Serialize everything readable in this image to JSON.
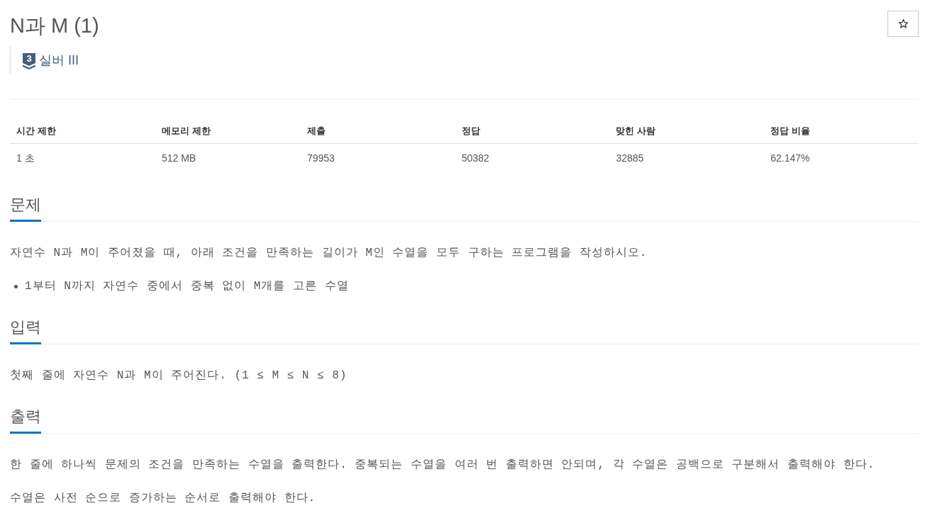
{
  "title": "N과 M (1)",
  "favorite_button": {
    "on": false
  },
  "tier": {
    "level": "3",
    "label": "실버 III"
  },
  "stats": {
    "columns": [
      "시간 제한",
      "메모리 제한",
      "제출",
      "정답",
      "맞힌 사람",
      "정답 비율"
    ],
    "rows": [
      [
        "1 초",
        "512 MB",
        "79953",
        "50382",
        "32885",
        "62.147%"
      ]
    ]
  },
  "sections": [
    {
      "heading": "문제",
      "blocks": [
        {
          "kind": "paragraph",
          "text": "자연수 N과 M이 주어졌을 때, 아래 조건을 만족하는 길이가 M인 수열을 모두 구하는 프로그램을 작성하시오."
        },
        {
          "kind": "bullet_list",
          "items": [
            "1부터 N까지 자연수 중에서 중복 없이 M개를 고른 수열"
          ]
        }
      ]
    },
    {
      "heading": "입력",
      "blocks": [
        {
          "kind": "paragraph",
          "text": "첫째 줄에 자연수 N과 M이 주어진다. (1 ≤ M ≤ N ≤ 8)"
        }
      ]
    },
    {
      "heading": "출력",
      "blocks": [
        {
          "kind": "paragraph",
          "text": "한 줄에 하나씩 문제의 조건을 만족하는 수열을 출력한다. 중복되는 수열을 여러 번 출력하면 안되며, 각 수열은 공백으로 구분해서 출력해야 한다."
        },
        {
          "kind": "paragraph",
          "text": "수열은 사전 순으로 증가하는 순서로 출력해야 한다."
        }
      ]
    }
  ]
}
